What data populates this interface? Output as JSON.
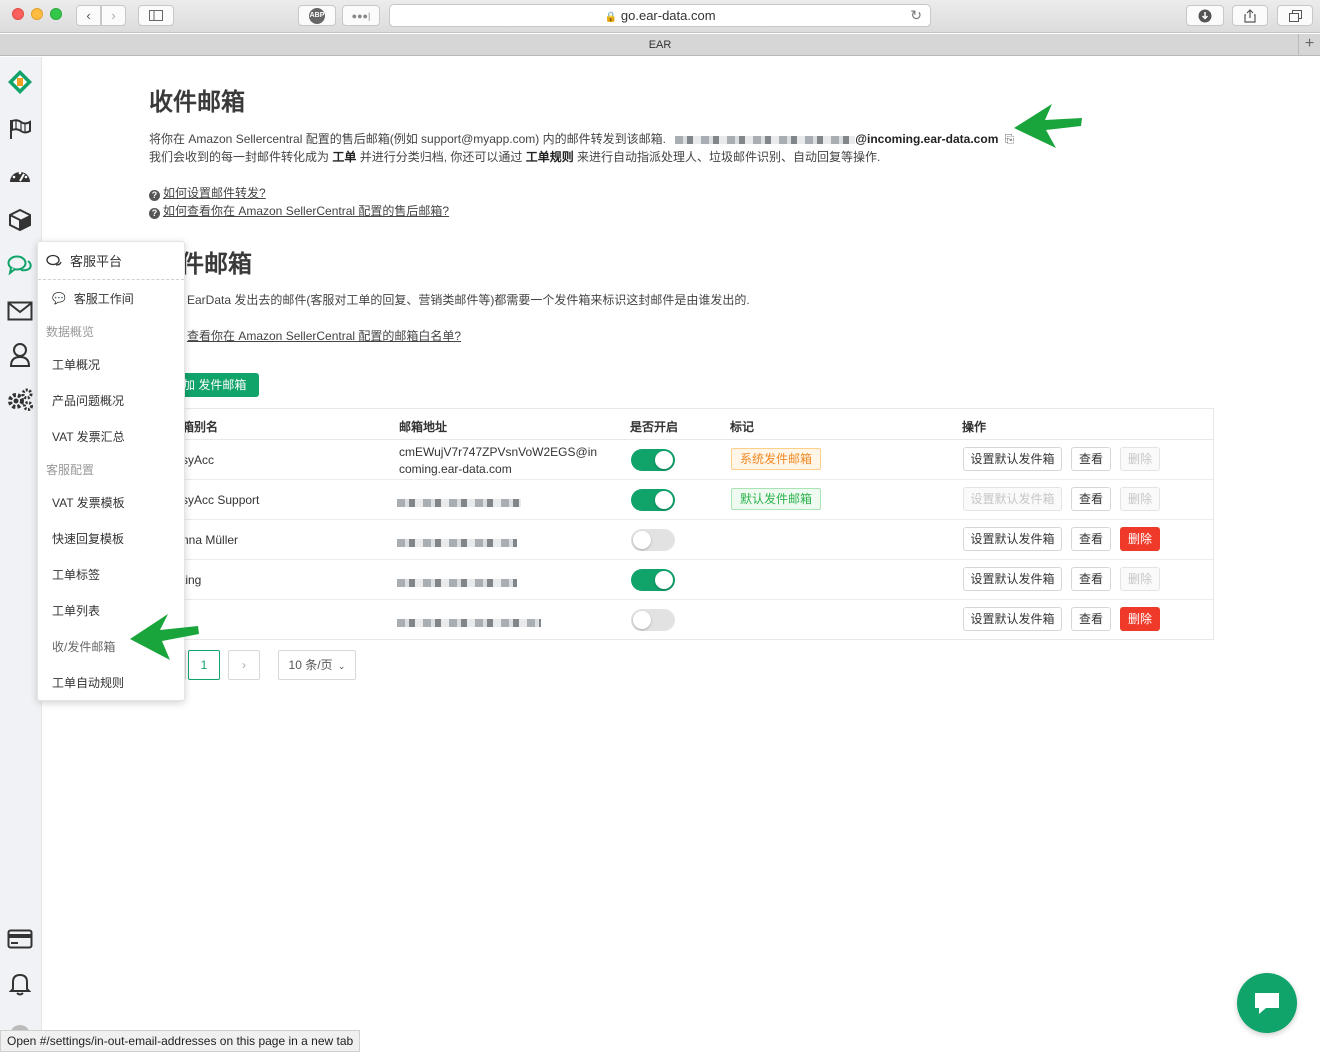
{
  "browser": {
    "address": "go.ear-data.com",
    "tab_title": "EAR",
    "abp_label": "ABP",
    "status_text": "Open #/settings/in-out-email-addresses on this page in a new tab"
  },
  "flyout": {
    "header": "客服平台",
    "workspace": "客服工作间",
    "group1": "数据概览",
    "items1": [
      "工单概况",
      "产品问题概况",
      "VAT 发票汇总"
    ],
    "group2": "客服配置",
    "items2": [
      "VAT 发票模板",
      "快速回复模板",
      "工单标签",
      "工单列表",
      "收/发件邮箱",
      "工单自动规则"
    ]
  },
  "inbox": {
    "title": "收件邮箱",
    "desc1_prefix": "将你在 Amazon Sellercentral 配置的售后邮箱(例如 support@myapp.com) 内的邮件转发到该邮箱.",
    "desc1_email_suffix": "@incoming.ear-data.com",
    "desc2_a": "我们会收到的每一封邮件转化成为 ",
    "desc2_b": "工单",
    "desc2_c": " 并进行分类归档, 你还可以通过 ",
    "desc2_d": "工单规则",
    "desc2_e": " 来进行自动指派处理人、垃圾邮件识别、自动回复等操作.",
    "help1": "如何设置邮件转发?",
    "help2": "如何查看你在 Amazon SellerCentral 配置的售后邮箱?"
  },
  "outbox": {
    "title_partial": "件邮箱",
    "desc": "EarData 发出去的邮件(客服对工单的回复、营销类邮件等)都需要一个发件箱来标识这封邮件是由谁发出的.",
    "help": "查看你在 Amazon SellerCentral 配置的邮箱白名单?",
    "add_button": "添加 发件邮箱",
    "add_button_visible": "加 发件邮箱"
  },
  "table": {
    "headers": [
      "箱别名",
      "邮箱地址",
      "是否开启",
      "标记",
      "操作"
    ],
    "rows": [
      {
        "alias": "syAcc",
        "email_line1": "cmEWujV7r747ZPVsnVoW2EGS@in",
        "email_line2": "coming.ear-data.com",
        "enabled": true,
        "tag": "系统发件邮箱",
        "tag_color": "orange",
        "default_disabled": false,
        "delete_style": "disabled"
      },
      {
        "alias": "syAcc Support",
        "email_line1": "",
        "email_line2": "",
        "enabled": true,
        "tag": "默认发件邮箱",
        "tag_color": "green",
        "default_disabled": true,
        "delete_style": "disabled"
      },
      {
        "alias": "nna Müller",
        "email_line1": "",
        "email_line2": "",
        "enabled": false,
        "tag": "",
        "tag_color": "",
        "default_disabled": false,
        "delete_style": "danger"
      },
      {
        "alias": "ting",
        "email_line1": "",
        "email_line2": "",
        "enabled": true,
        "tag": "",
        "tag_color": "",
        "default_disabled": false,
        "delete_style": "disabled"
      },
      {
        "alias": "",
        "email_line1": "",
        "email_line2": "",
        "enabled": false,
        "tag": "",
        "tag_color": "",
        "default_disabled": false,
        "delete_style": "danger"
      }
    ],
    "set_default_label": "设置默认发件箱",
    "view_label": "查看",
    "delete_label": "删除"
  },
  "pagination": {
    "current": "1",
    "next": "›",
    "page_size": "10 条/页"
  },
  "colors": {
    "accent": "#10a36a",
    "danger": "#ef3a2a",
    "tag_orange": "#f08a24",
    "tag_green": "#2bb24c",
    "arrow": "#1aa53c"
  }
}
